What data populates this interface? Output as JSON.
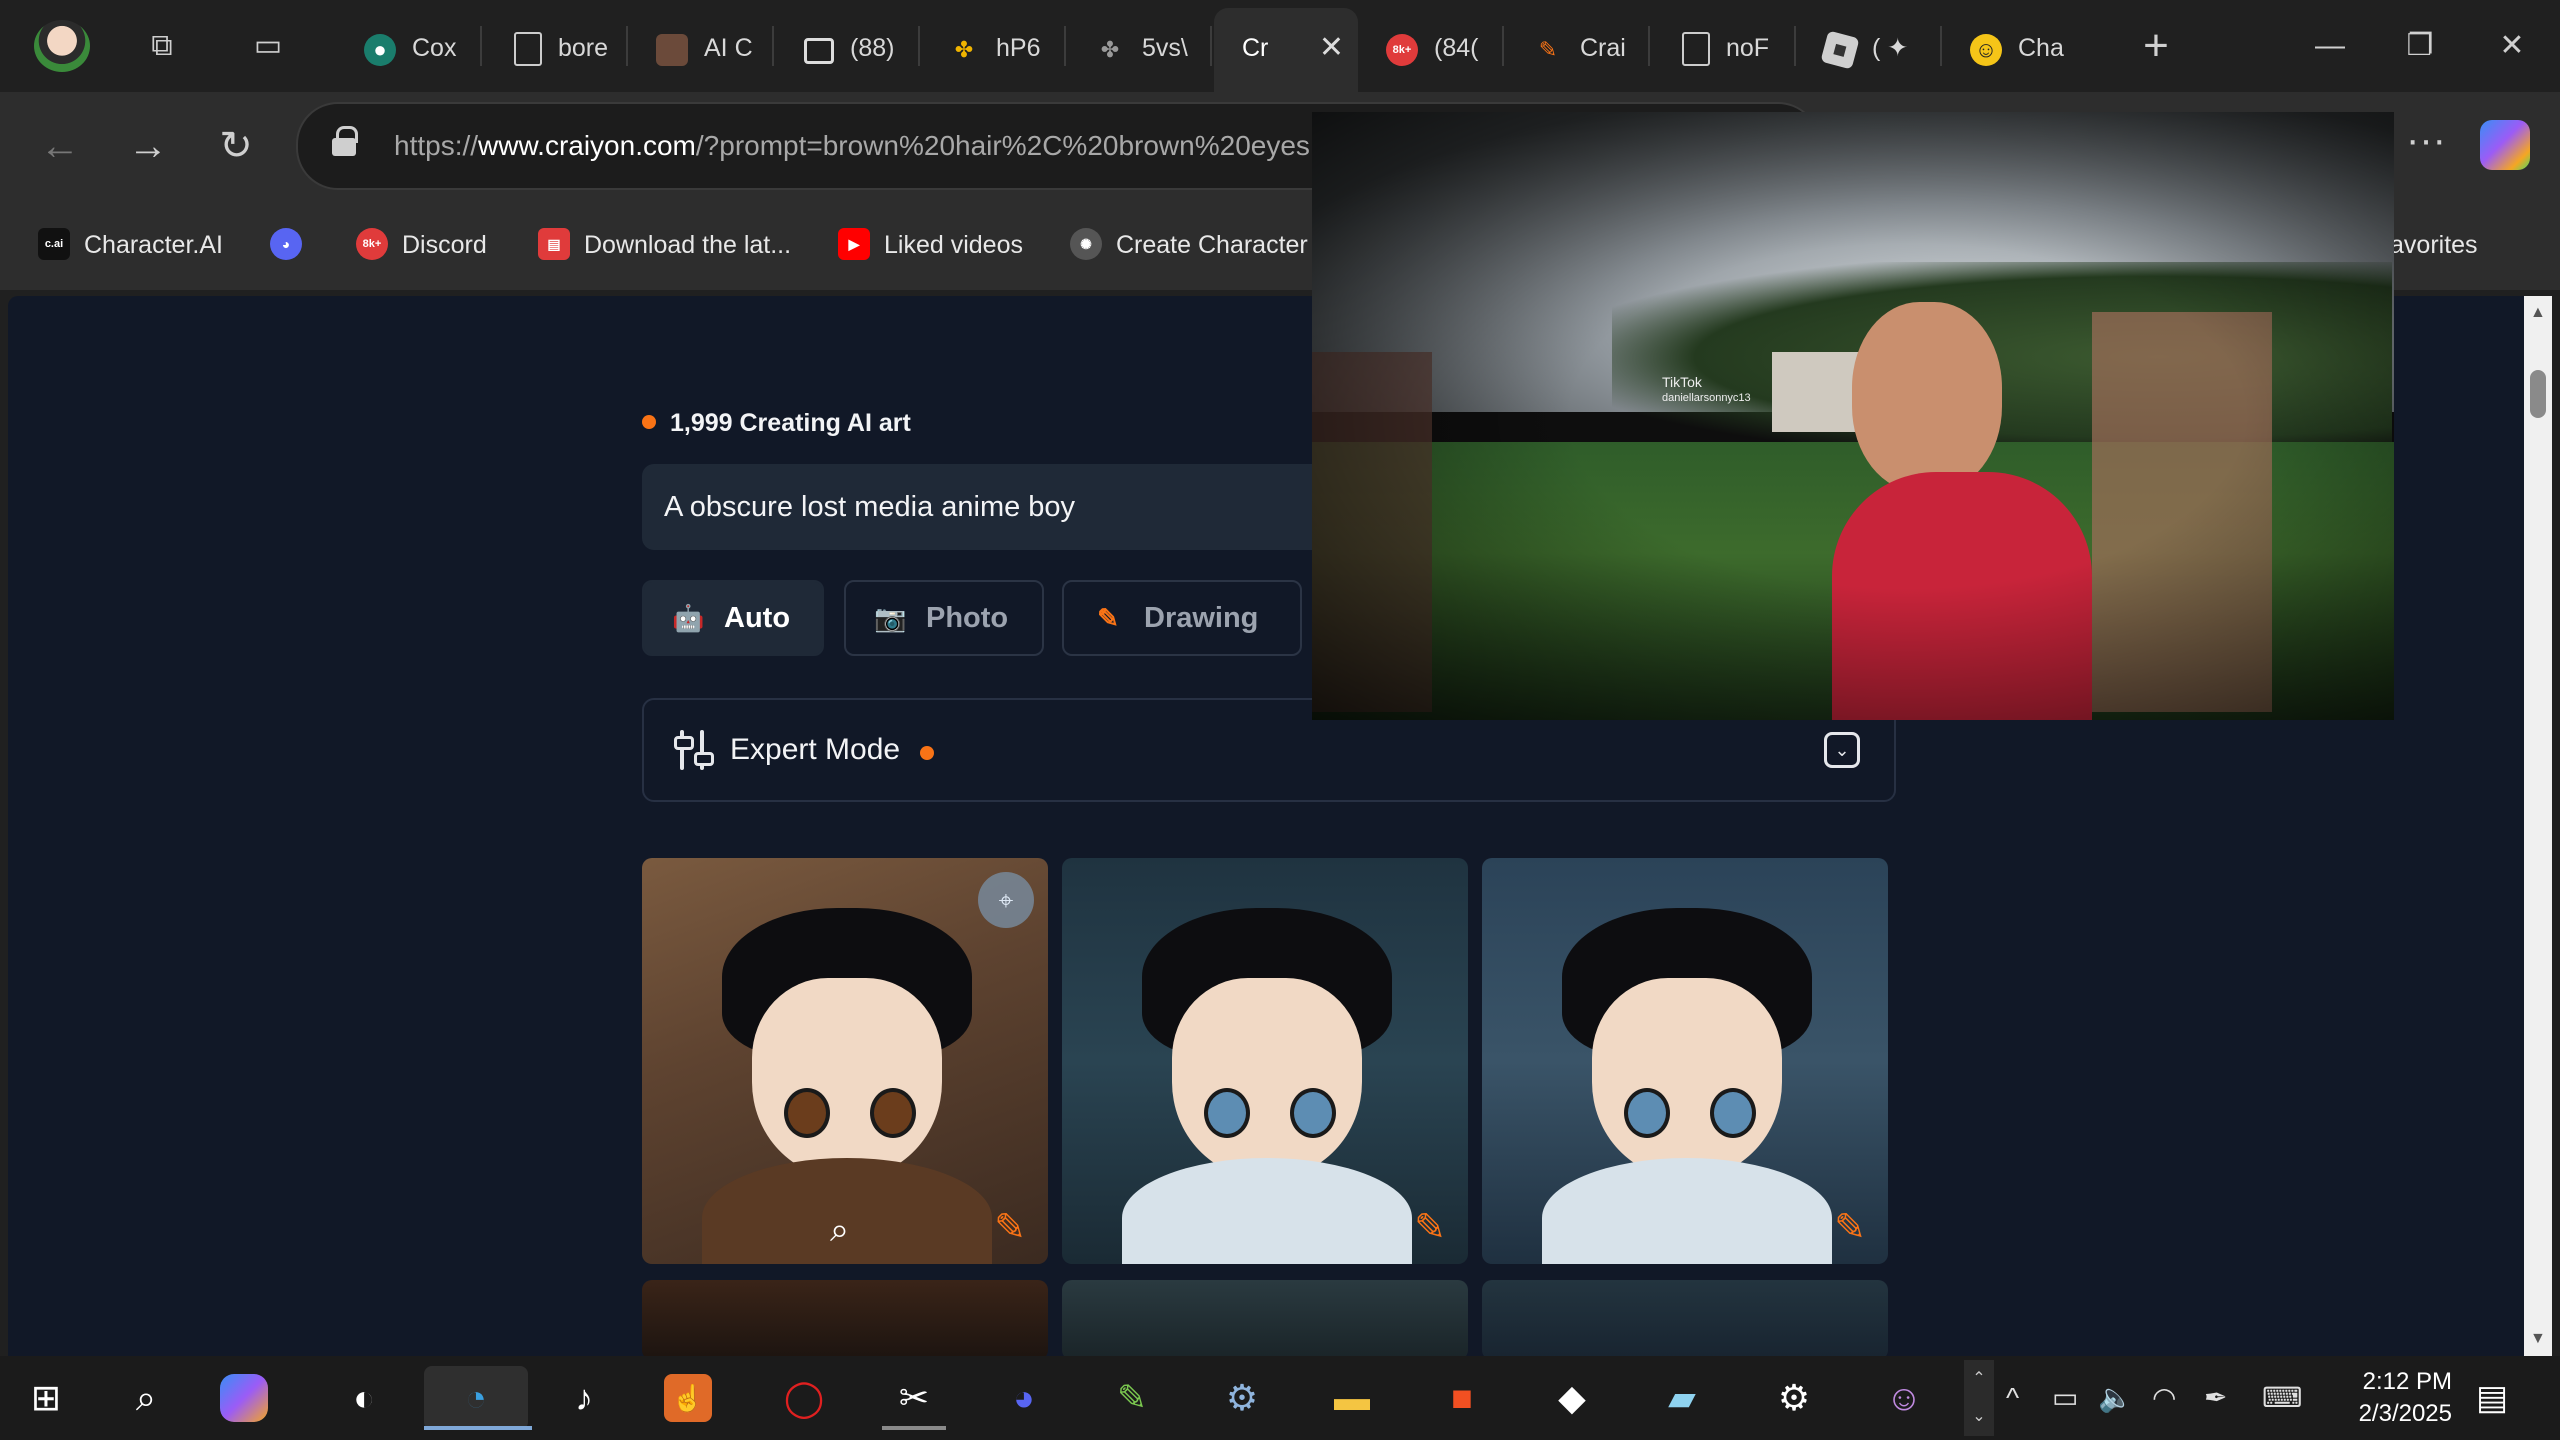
{
  "browser": {
    "tabs": [
      {
        "label": "Cox",
        "icon": "copilot-icon",
        "color": "#1a7d6c"
      },
      {
        "label": "bore",
        "icon": "document-icon",
        "color": "#777777"
      },
      {
        "label": "AI C",
        "icon": "avatar-icon",
        "color": "#6b4a3a"
      },
      {
        "label": "(88)",
        "icon": "image-icon",
        "color": "#444444"
      },
      {
        "label": "hP6",
        "icon": "pinwheel-icon",
        "color": "#e0a020"
      },
      {
        "label": "5vs\\",
        "icon": "pinwheel-icon",
        "color": "#8a8a8a"
      },
      {
        "label": "Cr",
        "icon": "none",
        "color": "#2d2d2d",
        "active": true
      },
      {
        "label": "(84(",
        "icon": "discord-8k-icon",
        "color": "#e03b3b"
      },
      {
        "label": "Crai",
        "icon": "pencil-icon",
        "color": "#f97316"
      },
      {
        "label": "noF",
        "icon": "document-icon",
        "color": "#777777"
      },
      {
        "label": "( ✦",
        "icon": "roblox-icon",
        "color": "#cfcfcf"
      },
      {
        "label": "Cha",
        "icon": "hugging-face-icon",
        "color": "#f5c518"
      }
    ],
    "url_prefix": "https://",
    "url_host": "www.craiyon.com",
    "url_path": "/?prompt=brown%20hair%2C%20brown%20eyes"
  },
  "favorites": [
    {
      "label": "Character.AI",
      "icon": "cai-icon",
      "color": "#111111",
      "badge": "c.ai"
    },
    {
      "label": "",
      "icon": "discord-icon",
      "color": "#5865f2",
      "badge": ""
    },
    {
      "label": "Discord",
      "icon": "discord-8k-icon",
      "color": "#e03b3b",
      "badge": "8k+"
    },
    {
      "label": "Download the lat...",
      "icon": "store-icon",
      "color": "#e03b3b",
      "badge": ""
    },
    {
      "label": "Liked videos",
      "icon": "youtube-icon",
      "color": "#ff0000",
      "badge": "▶"
    },
    {
      "label": "Create Character",
      "icon": "openai-icon",
      "color": "#444444",
      "badge": ""
    }
  ],
  "other_favorites": "ner favorites",
  "page": {
    "counter": "1,999 Creating AI art",
    "prompt": "A obscure lost media anime boy",
    "modes": [
      {
        "label": "Auto",
        "icon": "robot-icon",
        "active": true
      },
      {
        "label": "Photo",
        "icon": "camera-icon",
        "active": false
      },
      {
        "label": "Drawing",
        "icon": "pencil-icon",
        "active": false
      }
    ],
    "expert_mode": "Expert Mode"
  },
  "pip_video": {
    "watermark": "TikTok",
    "handle": "daniellarsonnyc13"
  },
  "taskbar": {
    "time": "2:12 PM",
    "date": "2/3/2025"
  },
  "colors": {
    "accent": "#f97316",
    "page_bg": "#111827"
  }
}
